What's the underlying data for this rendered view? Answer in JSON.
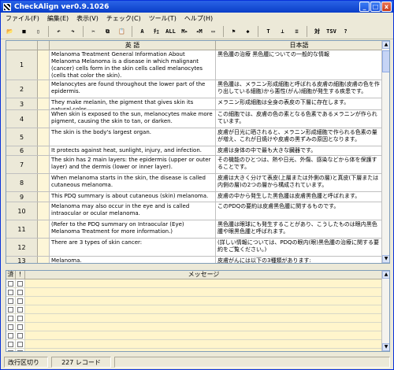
{
  "window": {
    "title": "CheckAlign ver0.9.1026",
    "minimize_label": "_",
    "maximize_label": "□",
    "close_label": "x"
  },
  "menu": [
    "ファイル(F)",
    "編集(E)",
    "表示(V)",
    "チェック(C)",
    "ツール(T)",
    "ヘルプ(H)"
  ],
  "toolbar": [
    {
      "name": "open-icon",
      "glyph": "📂"
    },
    {
      "name": "save-icon",
      "glyph": "■"
    },
    {
      "name": "new-icon",
      "glyph": "▯"
    },
    {
      "name": "undo-icon",
      "glyph": "↶"
    },
    {
      "name": "redo-icon",
      "glyph": "↷"
    },
    {
      "name": "cut-icon",
      "glyph": "✂"
    },
    {
      "name": "copy-icon",
      "glyph": "⧉"
    },
    {
      "name": "paste-icon",
      "glyph": "📋"
    },
    {
      "name": "font-icon",
      "glyph": "A"
    },
    {
      "name": "check-icon",
      "glyph": "ﾁｪ"
    },
    {
      "name": "check-all-icon",
      "glyph": "ALL"
    },
    {
      "name": "next-mismatch-icon",
      "glyph": "M▸"
    },
    {
      "name": "prev-mismatch-icon",
      "glyph": "◂M"
    },
    {
      "name": "pane-icon",
      "glyph": "▭"
    },
    {
      "name": "flag-icon",
      "glyph": "⚑"
    },
    {
      "name": "tag-icon",
      "glyph": "◆"
    },
    {
      "name": "text-icon",
      "glyph": "T"
    },
    {
      "name": "layout-icon",
      "glyph": "⊥"
    },
    {
      "name": "list-icon",
      "glyph": "≡"
    },
    {
      "name": "compare-icon",
      "glyph": "対"
    },
    {
      "name": "tsv-icon",
      "glyph": "TSV"
    },
    {
      "name": "help-icon",
      "glyph": "?"
    }
  ],
  "table": {
    "col_en": "英 語",
    "col_ja": "日本語",
    "rows": [
      {
        "n": "1",
        "en": "Melanoma Treatment General Information About Melanoma Melanoma is a disease in which malignant (cancer) cells form in the skin cells called melanocytes (cells that color the skin).",
        "ja": "黒色腫の治療 黒色腫についての一般的な情報"
      },
      {
        "n": "2",
        "en": "Melanocytes are found throughout the lower part of the epidermis.",
        "ja": "黒色腫は、メラニン形成細胞と呼ばれる皮膚の細胞(皮膚の色を作り出している細胞)から悪性(がん)細胞が発生する疾患です。"
      },
      {
        "n": "3",
        "en": "They make melanin, the pigment that gives skin its natural color.",
        "ja": "メラニン形成細胞は全身の表皮の下層に存在します。"
      },
      {
        "n": "4",
        "en": "When skin is exposed to the sun, melanocytes make more pigment, causing the skin to tan, or darken.",
        "ja": "この細胞では、皮膚の色の素となる色素であるメラニンが作られています。"
      },
      {
        "n": "5",
        "en": "The skin is the body's largest organ.",
        "ja": "皮膚が日光に晒されると、メラニン形成細胞で作られる色素の量が増え、これが日焼けや皮膚の黒ずみの原因となります。"
      },
      {
        "n": "6",
        "en": "It protects against heat, sunlight, injury, and infection.",
        "ja": "皮膚は身体の中で最も大きな臓器です。"
      },
      {
        "n": "7",
        "en": "The skin has 2 main layers: the epidermis (upper or outer layer) and the dermis (lower or inner layer).",
        "ja": "その機能のひとつは、熱や日光、外傷、感染などから体を保護することです。"
      },
      {
        "n": "8",
        "en": "When melanoma starts in the skin, the disease is called cutaneous melanoma.",
        "ja": "皮膚は大きく分けて表皮(上層または外側の層)と真皮(下層または内側の層)の2つの層から構成されています。"
      },
      {
        "n": "9",
        "en": "This PDQ summary is about cutaneous (skin) melanoma.",
        "ja": "皮膚の中から発生した黒色腫は皮膚黒色腫と呼ばれます。"
      },
      {
        "n": "10",
        "en": "Melanoma may also occur in the eye and is called intraocular or ocular melanoma.",
        "ja": "このPDQの要約は皮膚黒色腫に関するものです。"
      },
      {
        "n": "11",
        "en": "(Refer to the PDQ summary on Intraocular (Eye) Melanoma Treatment for more information.)",
        "ja": "黒色腫は眼球にも発生することがあり、こうしたものは眼内黒色腫や眼黒色腫と呼ばれます。"
      },
      {
        "n": "12",
        "en": "There are 3 types of skin cancer:",
        "ja": "(詳しい情報については、PDQの眼内(眼)黒色腫の治療に関する要約をご覧ください。)"
      },
      {
        "n": "13",
        "en": "Melanoma.",
        "ja": "皮膚がんには以下の3種類があります:"
      }
    ]
  },
  "messages": {
    "col_check": "済",
    "col_flag": "!",
    "col_message": "メッセージ",
    "row_count": 9
  },
  "status": {
    "mode": "改行区切り",
    "count": "227 レコード"
  }
}
